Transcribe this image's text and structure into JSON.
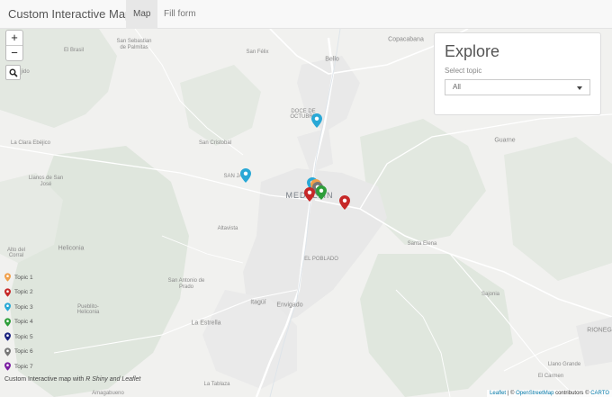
{
  "app": {
    "title": "Custom Interactive Map"
  },
  "tabs": [
    {
      "label": "Map",
      "active": true
    },
    {
      "label": "Fill form",
      "active": false
    }
  ],
  "zoom": {
    "in": "+",
    "out": "−"
  },
  "explore": {
    "title": "Explore",
    "select_label": "Select topic",
    "selected": "All"
  },
  "legend": [
    {
      "label": "Topic 1",
      "color": "#f0a04b"
    },
    {
      "label": "Topic 2",
      "color": "#c62828"
    },
    {
      "label": "Topic 3",
      "color": "#29a8d6"
    },
    {
      "label": "Topic 4",
      "color": "#2e9e3a"
    },
    {
      "label": "Topic 5",
      "color": "#1a237e"
    },
    {
      "label": "Topic 6",
      "color": "#777777"
    },
    {
      "label": "Topic 7",
      "color": "#7b1fa2"
    }
  ],
  "caption": {
    "prefix": "Custom Interactive map with ",
    "tech": "R Shiny and Leaflet"
  },
  "attribution": {
    "leaflet": "Leaflet",
    "sep": " | © ",
    "osm": "OpenStreetMap",
    "contrib": " contributors © ",
    "carto": "CARTO"
  },
  "places": {
    "copacabana": "Copacabana",
    "san_sebastian": "San Sebastian",
    "de_palmitas": "de Palmitas",
    "el_brasil": "El Brasil",
    "san_felix": "San Félix",
    "bello": "Bello",
    "ejido": "jido",
    "doce_de": "DOCE DE",
    "octubre": "OCTUBRE",
    "la_clara_ebejico": "La Clara Ebéjico",
    "san_cristobal": "San Cristobal",
    "guarne": "Guarne",
    "llanos_de_san": "Llanos de San",
    "jose": "José",
    "san_javier": "SAN JA",
    "medellin": "MEDELLÍN",
    "altavista": "Altavista",
    "heliconia": "Heliconia",
    "santa_elena": "Santa Elena",
    "el_poblado": "EL POBLADO",
    "alto_del": "Alto del",
    "corral": "Corral",
    "san_antonio_de": "San Antonio de",
    "prado": "Prado",
    "sajonia": "Sajonia",
    "itagui": "Itagüí",
    "envigado": "Envigado",
    "pueblito": "Pueblito-",
    "heliconia2": "Heliconia",
    "la_estrella": "La Estrella",
    "rionegro": "RIONEG",
    "la_tablaza": "La Tablaza",
    "llano_grande": "Llano Grande",
    "el_carmen": "El Carmen",
    "amagabueno": "Amagabueno"
  }
}
